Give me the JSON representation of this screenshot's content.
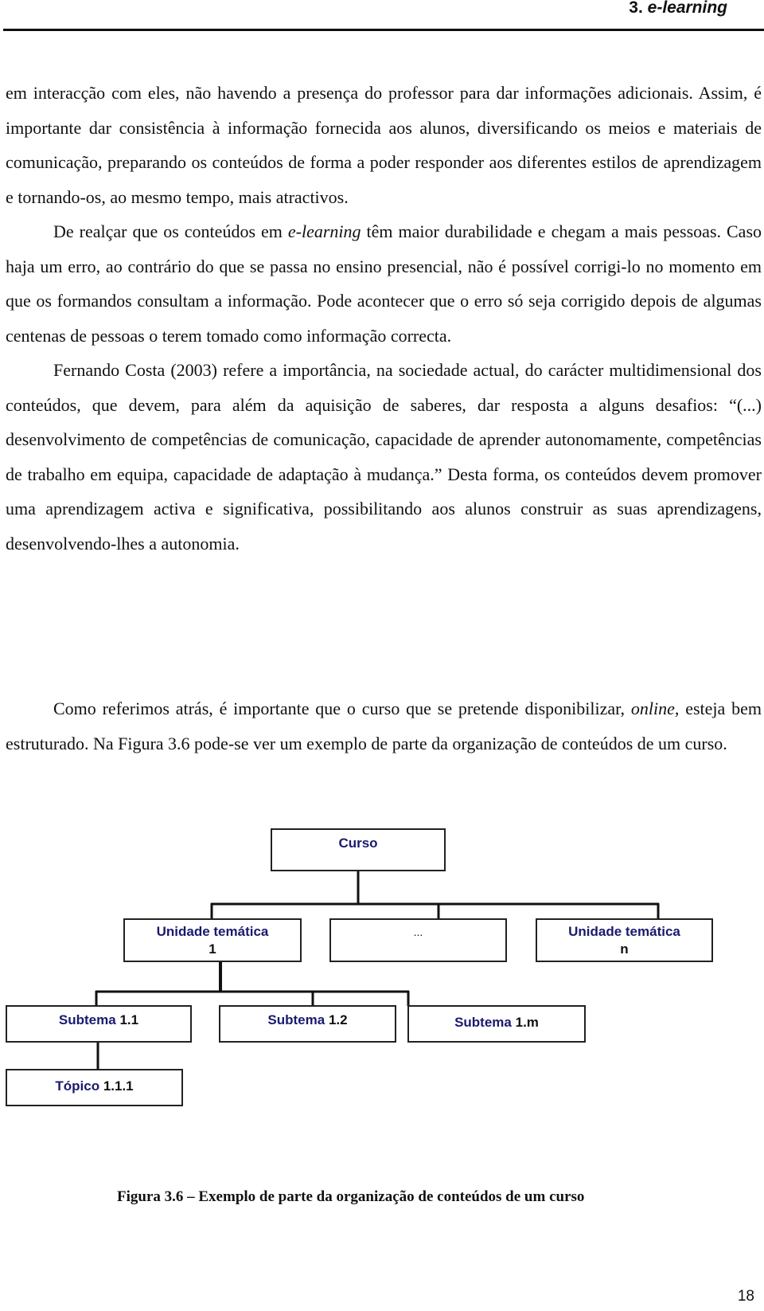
{
  "header": {
    "chapter_number": "3.",
    "chapter_title": "e-learning"
  },
  "paragraphs_top": [
    {
      "indent": false,
      "segments": [
        {
          "text": "em interacção com eles, não havendo a presença do professor para dar informações adicionais. Assim, é importante dar consistência à informação fornecida aos alunos, diversificando os meios e materiais de comunicação, preparando os conteúdos de forma a poder responder aos diferentes estilos de aprendizagem e tornando-os, ao mesmo tempo, mais atractivos.",
          "italic": false
        }
      ]
    },
    {
      "indent": true,
      "segments": [
        {
          "text": "De realçar que os conteúdos em ",
          "italic": false
        },
        {
          "text": "e-learning",
          "italic": true
        },
        {
          "text": " têm maior durabilidade e chegam a mais pessoas. Caso haja um erro, ao contrário do que se passa no ensino presencial, não é possível corrigi-lo no momento em que os formandos consultam a informação. Pode acontecer que o erro só seja corrigido depois de algumas centenas de pessoas o terem tomado como informação correcta.",
          "italic": false
        }
      ]
    },
    {
      "indent": true,
      "segments": [
        {
          "text": "Fernando Costa (2003) refere a importância, na sociedade actual, do carácter multidimensional dos conteúdos, que devem, para além da aquisição de saberes, dar resposta a alguns desafios: “(...) desenvolvimento de competências de comunicação, capacidade de aprender autonomamente, competências de trabalho em equipa, capacidade de adaptação à mudança.” Desta forma, os conteúdos devem promover uma aprendizagem activa e significativa, possibilitando aos alunos construir as suas aprendizagens, desenvolvendo-lhes a autonomia.",
          "italic": false
        }
      ]
    }
  ],
  "paragraphs_bottom": [
    {
      "indent": true,
      "segments": [
        {
          "text": "Como referimos atrás, é importante que o curso que se pretende disponibilizar, ",
          "italic": false
        },
        {
          "text": "online",
          "italic": true
        },
        {
          "text": ", esteja bem estruturado. Na Figura 3.6 pode-se ver um exemplo de parte da organização de conteúdos de um curso.",
          "italic": false
        }
      ]
    }
  ],
  "diagram": {
    "title": "Organização de conteúdos de um curso",
    "label_color": "#1a1a6e",
    "nodes": {
      "curso": {
        "label": "Curso",
        "num": ""
      },
      "unidade_1": {
        "label": "Unidade temática",
        "num": "1"
      },
      "ellipsis": {
        "label": "...",
        "num": ""
      },
      "unidade_n": {
        "label": "Unidade temática",
        "num": "n"
      },
      "subtema_1_1": {
        "label": "Subtema",
        "num": "1.1"
      },
      "subtema_1_2": {
        "label": "Subtema",
        "num": "1.2"
      },
      "subtema_1_m": {
        "label": "Subtema",
        "num": "1.m"
      },
      "topico_1_1_1": {
        "label": "Tópico",
        "num": "1.1.1"
      }
    }
  },
  "caption": "Figura 3.6 – Exemplo de parte da organização de conteúdos de um curso",
  "page_number": "18"
}
